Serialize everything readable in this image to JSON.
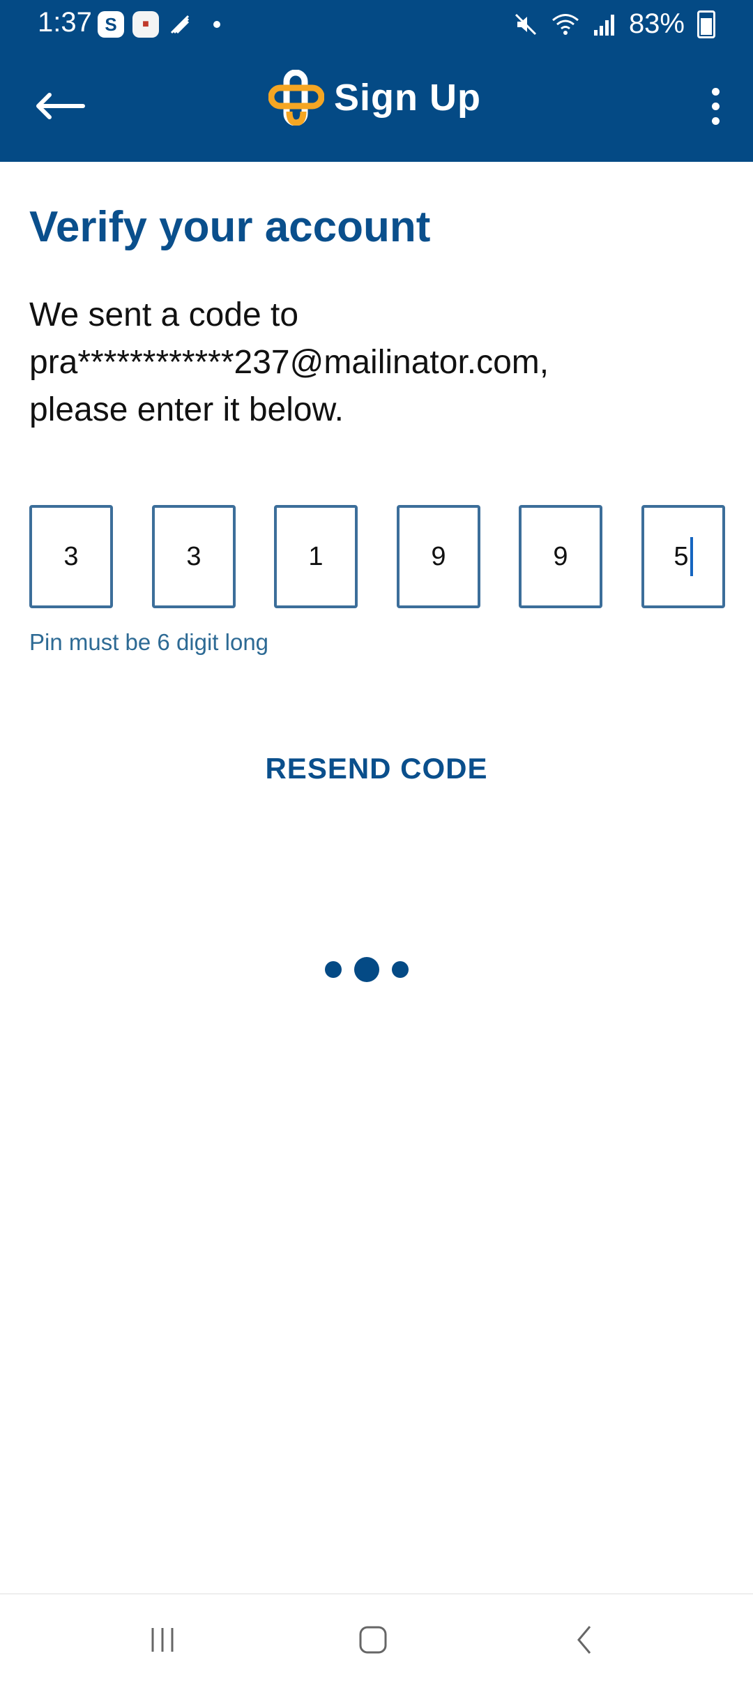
{
  "status_bar": {
    "time": "1:37",
    "notification_icons": [
      "skype-icon",
      "game-icon",
      "satellite-icon",
      "dot"
    ],
    "battery": "83%",
    "right_icons": [
      "mute-icon",
      "wifi-icon",
      "signal-icon",
      "battery-charging-icon"
    ]
  },
  "app_bar": {
    "title": "Sign Up",
    "back_icon": "arrow-left-icon",
    "menu_icon": "more-vert-icon",
    "colors": {
      "bar": "#044a85",
      "logo_orange": "#f5a623"
    }
  },
  "screen": {
    "heading": "Verify your account",
    "description_lines": [
      "We sent a code to",
      "pra************237@mailinator.com,",
      "please enter it below."
    ],
    "pin_digits": [
      "3",
      "3",
      "1",
      "9",
      "9",
      "5"
    ],
    "hint": "Pin must be 6 digit long",
    "resend_label": "RESEND CODE"
  },
  "nav_bar": {
    "buttons": [
      "recents-icon",
      "home-icon",
      "back-icon"
    ]
  }
}
